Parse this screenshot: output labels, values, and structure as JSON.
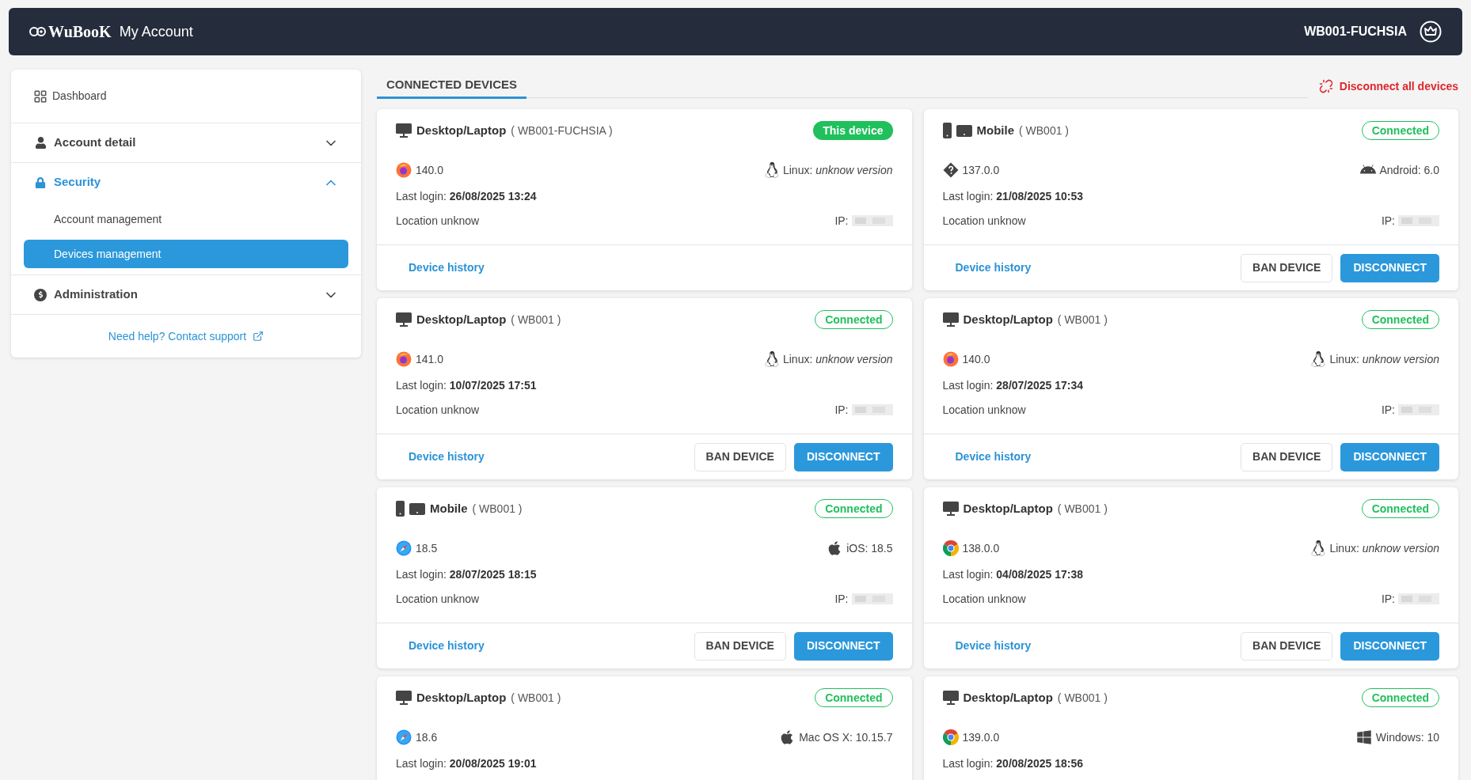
{
  "header": {
    "logo": "WuBooK",
    "title": "My Account",
    "account": "WB001-FUCHSIA"
  },
  "sidebar": {
    "items": [
      {
        "kind": "link",
        "label": "Dashboard"
      },
      {
        "kind": "group",
        "label": "Account detail",
        "expanded": false
      },
      {
        "kind": "group",
        "label": "Security",
        "expanded": true,
        "children": [
          {
            "label": "Account management",
            "selected": false
          },
          {
            "label": "Devices management",
            "selected": true
          }
        ]
      },
      {
        "kind": "group",
        "label": "Administration",
        "expanded": false
      }
    ],
    "help": "Need help? Contact support"
  },
  "tabs": [
    {
      "label": "CONNECTED DEVICES",
      "selected": true
    }
  ],
  "disconnect_all": "Disconnect all devices",
  "devices": [
    {
      "kind": "desktop",
      "type": "Desktop/Laptop",
      "account": "( WB001-FUCHSIA )",
      "current": true,
      "status": "This device",
      "browser": {
        "kind": "firefox",
        "version": "140.0"
      },
      "os": {
        "kind": "linux",
        "text": "Linux: *unknow version*"
      },
      "last_login_label": "Last login:",
      "last_login": "26/08/2025 13:24",
      "location": "Location unknow",
      "ip_label": "IP:",
      "history": "Device history"
    },
    {
      "kind": "mobile",
      "type": "Mobile",
      "account": "( WB001 )",
      "current": false,
      "status": "Connected",
      "browser": {
        "kind": "unknown",
        "version": "137.0.0"
      },
      "os": {
        "kind": "android",
        "text": "Android: 6.0"
      },
      "last_login_label": "Last login:",
      "last_login": "21/08/2025 10:53",
      "location": "Location unknow",
      "ip_label": "IP:",
      "history": "Device history",
      "ban": "BAN DEVICE",
      "disconnect": "DISCONNECT"
    },
    {
      "kind": "desktop",
      "type": "Desktop/Laptop",
      "account": "( WB001 )",
      "current": false,
      "status": "Connected",
      "browser": {
        "kind": "firefox",
        "version": "141.0"
      },
      "os": {
        "kind": "linux",
        "text": "Linux: *unknow version*"
      },
      "last_login_label": "Last login:",
      "last_login": "10/07/2025 17:51",
      "location": "Location unknow",
      "ip_label": "IP:",
      "history": "Device history",
      "ban": "BAN DEVICE",
      "disconnect": "DISCONNECT"
    },
    {
      "kind": "desktop",
      "type": "Desktop/Laptop",
      "account": "( WB001 )",
      "current": false,
      "status": "Connected",
      "browser": {
        "kind": "firefox",
        "version": "140.0"
      },
      "os": {
        "kind": "linux",
        "text": "Linux: *unknow version*"
      },
      "last_login_label": "Last login:",
      "last_login": "28/07/2025 17:34",
      "location": "Location unknow",
      "ip_label": "IP:",
      "history": "Device history",
      "ban": "BAN DEVICE",
      "disconnect": "DISCONNECT"
    },
    {
      "kind": "mobile",
      "type": "Mobile",
      "account": "( WB001 )",
      "current": false,
      "status": "Connected",
      "browser": {
        "kind": "safari",
        "version": "18.5"
      },
      "os": {
        "kind": "apple",
        "text": "iOS: 18.5"
      },
      "last_login_label": "Last login:",
      "last_login": "28/07/2025 18:15",
      "location": "Location unknow",
      "ip_label": "IP:",
      "history": "Device history",
      "ban": "BAN DEVICE",
      "disconnect": "DISCONNECT"
    },
    {
      "kind": "desktop",
      "type": "Desktop/Laptop",
      "account": "( WB001 )",
      "current": false,
      "status": "Connected",
      "browser": {
        "kind": "chrome",
        "version": "138.0.0"
      },
      "os": {
        "kind": "linux",
        "text": "Linux: *unknow version*"
      },
      "last_login_label": "Last login:",
      "last_login": "04/08/2025 17:38",
      "location": "Location unknow",
      "ip_label": "IP:",
      "history": "Device history",
      "ban": "BAN DEVICE",
      "disconnect": "DISCONNECT"
    },
    {
      "kind": "desktop",
      "type": "Desktop/Laptop",
      "account": "( WB001 )",
      "current": false,
      "status": "Connected",
      "browser": {
        "kind": "safari",
        "version": "18.6"
      },
      "os": {
        "kind": "apple",
        "text": "Mac OS X: 10.15.7"
      },
      "last_login_label": "Last login:",
      "last_login": "20/08/2025 19:01"
    },
    {
      "kind": "desktop",
      "type": "Desktop/Laptop",
      "account": "( WB001 )",
      "current": false,
      "status": "Connected",
      "browser": {
        "kind": "chrome",
        "version": "139.0.0"
      },
      "os": {
        "kind": "windows",
        "text": "Windows: 10"
      },
      "last_login_label": "Last login:",
      "last_login": "20/08/2025 18:56"
    }
  ]
}
